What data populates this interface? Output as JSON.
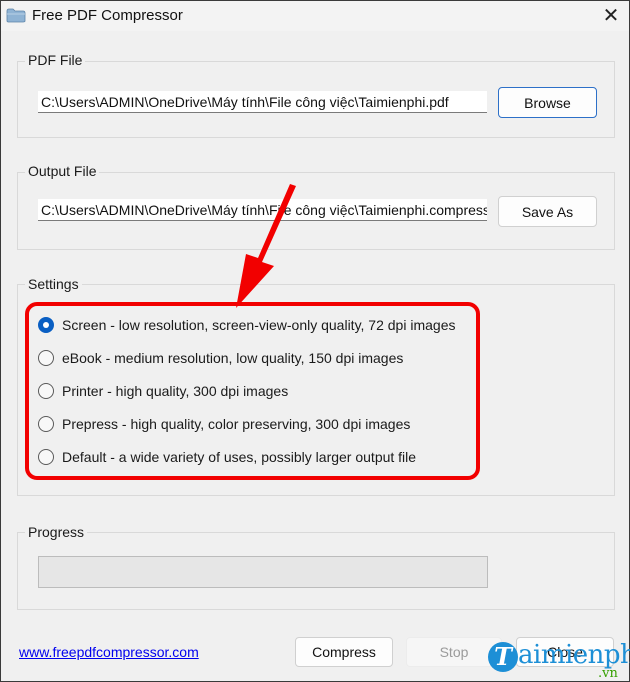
{
  "window": {
    "title": "Free PDF Compressor",
    "close_label": "✕",
    "app_icon": "folder-icon"
  },
  "pdf_file": {
    "group_label": "PDF File",
    "path": "C:\\Users\\ADMIN\\OneDrive\\Máy tính\\File công việc\\Taimienphi.pdf",
    "browse_label": "Browse"
  },
  "output_file": {
    "group_label": "Output File",
    "path": "C:\\Users\\ADMIN\\OneDrive\\Máy tính\\File công việc\\Taimienphi.compressed.pdf",
    "save_as_label": "Save As"
  },
  "settings": {
    "group_label": "Settings",
    "selected": "Screen",
    "options": [
      {
        "label": "Screen - low resolution, screen-view-only quality, 72 dpi images",
        "checked": true
      },
      {
        "label": "eBook - medium resolution, low quality, 150 dpi images",
        "checked": false
      },
      {
        "label": "Printer - high quality, 300 dpi images",
        "checked": false
      },
      {
        "label": "Prepress - high quality, color preserving, 300 dpi images",
        "checked": false
      },
      {
        "label": "Default - a wide variety of uses, possibly larger output file",
        "checked": false
      }
    ]
  },
  "progress": {
    "group_label": "Progress",
    "value_percent": 0
  },
  "footer": {
    "link_text": "www.freepdfcompressor.com",
    "compress_label": "Compress",
    "stop_label": "Stop",
    "close_label": "Close"
  },
  "annotation": {
    "highlight_color": "#f20000"
  },
  "watermark": {
    "logo_letter": "T",
    "text": "aimienphi",
    "suffix": ".vn"
  }
}
